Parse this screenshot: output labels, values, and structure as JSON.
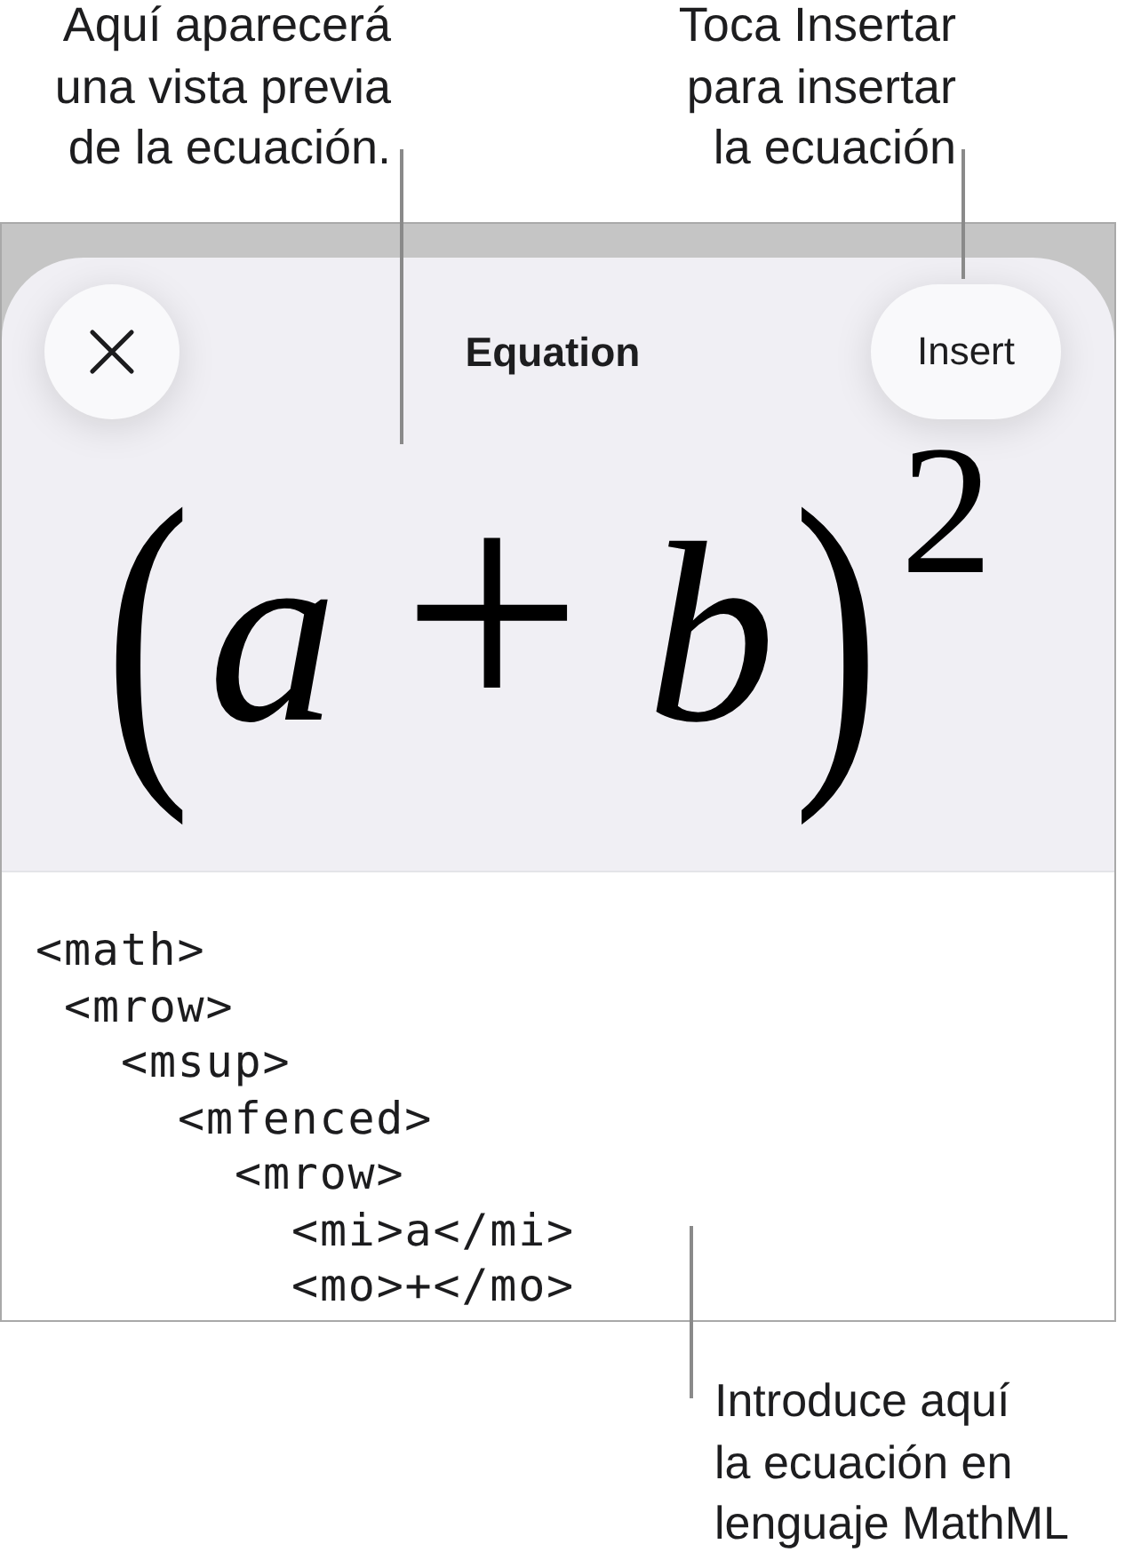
{
  "callouts": {
    "preview": "Aquí aparecerá\nuna vista previa\nde la ecuación.",
    "insert": "Toca Insertar\npara insertar\nla ecuación",
    "editor": "Introduce aquí\nla ecuación en\nlenguaje MathML"
  },
  "sheet": {
    "title": "Equation",
    "insert_button": "Insert"
  },
  "equation": {
    "base": [
      {
        "kind": "fence",
        "text": "("
      },
      {
        "kind": "identifier",
        "text": "a"
      },
      {
        "kind": "operator",
        "text": "+"
      },
      {
        "kind": "identifier",
        "text": "b"
      },
      {
        "kind": "fence",
        "text": ")"
      }
    ],
    "exponent": "2"
  },
  "editor": {
    "lines": [
      {
        "text": "<math>",
        "children": [
          {
            "text": "<mrow>",
            "children": [
              {
                "text": "<msup>",
                "children": [
                  {
                    "text": "<mfenced>",
                    "children": [
                      {
                        "text": "<mrow>",
                        "children": [
                          {
                            "text": "<mi>a</mi>"
                          },
                          {
                            "text": "<mo>+</mo>"
                          }
                        ]
                      }
                    ]
                  }
                ]
              }
            ]
          }
        ]
      }
    ]
  }
}
